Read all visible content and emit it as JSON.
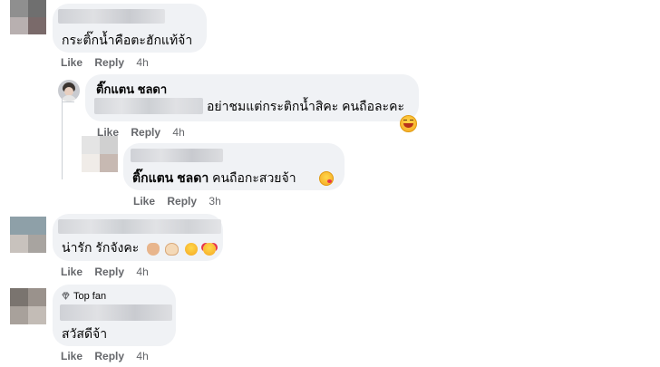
{
  "comments": [
    {
      "text": "กระติ๊กน้ำคือตะฮักแท้จ้า",
      "actions": {
        "like": "Like",
        "reply": "Reply",
        "time": "4h"
      }
    },
    {
      "author": "ติ๊กแตน ชลดา",
      "text": "อย่าชมแต่กระติกน้ำสิคะ คนถือละคะ",
      "emoji": "laughing-emoji",
      "actions": {
        "like": "Like",
        "reply": "Reply",
        "time": "4h"
      }
    },
    {
      "mention": "ติ๊กแตน ชลดา",
      "text": " คนถือกะสวยจ้า",
      "emoji": "kissing-emoji",
      "actions": {
        "like": "Like",
        "reply": "Reply",
        "time": "3h"
      }
    },
    {
      "text": "น่ารัก รักจังคะ",
      "emojis": [
        "heart-hands-emoji",
        "heart-hands-emoji",
        "kissing-emoji",
        "smiling-hearts-emoji"
      ],
      "actions": {
        "like": "Like",
        "reply": "Reply",
        "time": "4h"
      }
    },
    {
      "badge": "Top fan",
      "text": "สวัสดีจ้า",
      "actions": {
        "like": "Like",
        "reply": "Reply",
        "time": "4h"
      }
    }
  ],
  "colors": {
    "bubble": "#f0f2f5",
    "meta": "#65676b",
    "text": "#050505"
  }
}
